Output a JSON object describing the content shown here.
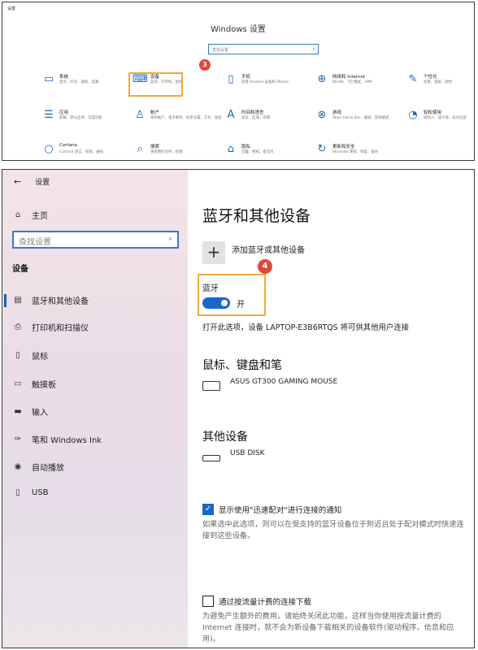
{
  "top": {
    "window_caption": "设置",
    "home_title": "Windows 设置",
    "search_placeholder": "查找设置",
    "search_icon": "search-icon",
    "step_badge": "3",
    "tiles": [
      {
        "icon": "laptop-icon",
        "glyph": "▭",
        "title": "系统",
        "subtitle": "显示、声音、通知、电源"
      },
      {
        "icon": "devices-icon",
        "glyph": "⌨",
        "title": "设备",
        "subtitle": "蓝牙、打印机、鼠标"
      },
      {
        "icon": "phone-icon",
        "glyph": "▯",
        "title": "手机",
        "subtitle": "连接 Android 设备和 iPhone"
      },
      {
        "icon": "globe-icon",
        "glyph": "⊕",
        "title": "网络和 Internet",
        "subtitle": "WLAN、飞行模式、VPN"
      },
      {
        "icon": "personalization-icon",
        "glyph": "✎",
        "title": "个性化",
        "subtitle": "背景、锁屏、颜色"
      },
      {
        "icon": "apps-icon",
        "glyph": "☰",
        "title": "应用",
        "subtitle": "卸载、默认应用、可选功能"
      },
      {
        "icon": "account-icon",
        "glyph": "♙",
        "title": "帐户",
        "subtitle": "你的帐户、电子邮件、同步设置、工作、家庭"
      },
      {
        "icon": "time-language-icon",
        "glyph": "A",
        "title": "时间和语言",
        "subtitle": "语音、区域、日期"
      },
      {
        "icon": "xbox-icon",
        "glyph": "⊗",
        "title": "游戏",
        "subtitle": "Xbox Game Bar、截屏、游戏模式"
      },
      {
        "icon": "ease-of-access-icon",
        "glyph": "◔",
        "title": "轻松使用",
        "subtitle": "讲述人、放大镜、高对比度"
      },
      {
        "icon": "cortana-icon",
        "glyph": "○",
        "title": "Cortana",
        "subtitle": "Cortana 语言、权限、通知"
      },
      {
        "icon": "search-tile-icon",
        "glyph": "⌕",
        "title": "搜索",
        "subtitle": "查找我的文件、权限"
      },
      {
        "icon": "privacy-icon",
        "glyph": "⌂",
        "title": "隐私",
        "subtitle": "位置、相机、麦克风"
      },
      {
        "icon": "update-icon",
        "glyph": "↻",
        "title": "更新和安全",
        "subtitle": "Windows 更新、恢复、备份"
      }
    ]
  },
  "bottom": {
    "sidebar": {
      "back_icon": "back-arrow-icon",
      "header": "设置",
      "home": "主页",
      "search_placeholder": "查找设置",
      "section": "设备",
      "items": [
        {
          "icon": "bluetooth-devices-icon",
          "glyph": "▤",
          "label": "蓝牙和其他设备"
        },
        {
          "icon": "printer-icon",
          "glyph": "⎙",
          "label": "打印机和扫描仪"
        },
        {
          "icon": "mouse-icon",
          "glyph": "▯",
          "label": "鼠标"
        },
        {
          "icon": "touchpad-icon",
          "glyph": "▭",
          "label": "触摸板"
        },
        {
          "icon": "keyboard-icon",
          "glyph": "▬",
          "label": "输入"
        },
        {
          "icon": "pen-icon",
          "glyph": "✑",
          "label": "笔和 Windows Ink"
        },
        {
          "icon": "autoplay-icon",
          "glyph": "◉",
          "label": "自动播放"
        },
        {
          "icon": "usb-icon",
          "glyph": "▯",
          "label": "USB"
        }
      ]
    },
    "main": {
      "title": "蓝牙和其他设备",
      "add_label": "添加蓝牙或其他设备",
      "step_badge": "4",
      "bluetooth_label": "蓝牙",
      "bluetooth_state": "开",
      "bluetooth_on": true,
      "discoverable_text": "打开此选项，设备 LAPTOP-E3B6RTQS 将可供其他用户连接",
      "mouse_section": "鼠标、键盘和笔",
      "mouse_device": "ASUS GT300 GAMING MOUSE",
      "other_section": "其他设备",
      "other_device": "USB DISK",
      "swift_pair_label": "显示使用\"迅速配对\"进行连接的通知",
      "swift_pair_checked": true,
      "swift_pair_desc": "如果选中此选项，则可以在受支持的蓝牙设备位于附近且处于配对模式时快速连接到这些设备。",
      "metered_label": "通过按流量计费的连接下载",
      "metered_checked": false,
      "metered_desc": "为避免产生额外的费用，请始终关闭此功能，这样当你使用按流量计费的 Internet 连接时，就不会为新设备下载相关的设备软件(驱动程序、信息和应用)。"
    }
  },
  "colors": {
    "accent": "#1a67c8",
    "highlight": "#f0a93a",
    "badge": "#e0473a"
  }
}
